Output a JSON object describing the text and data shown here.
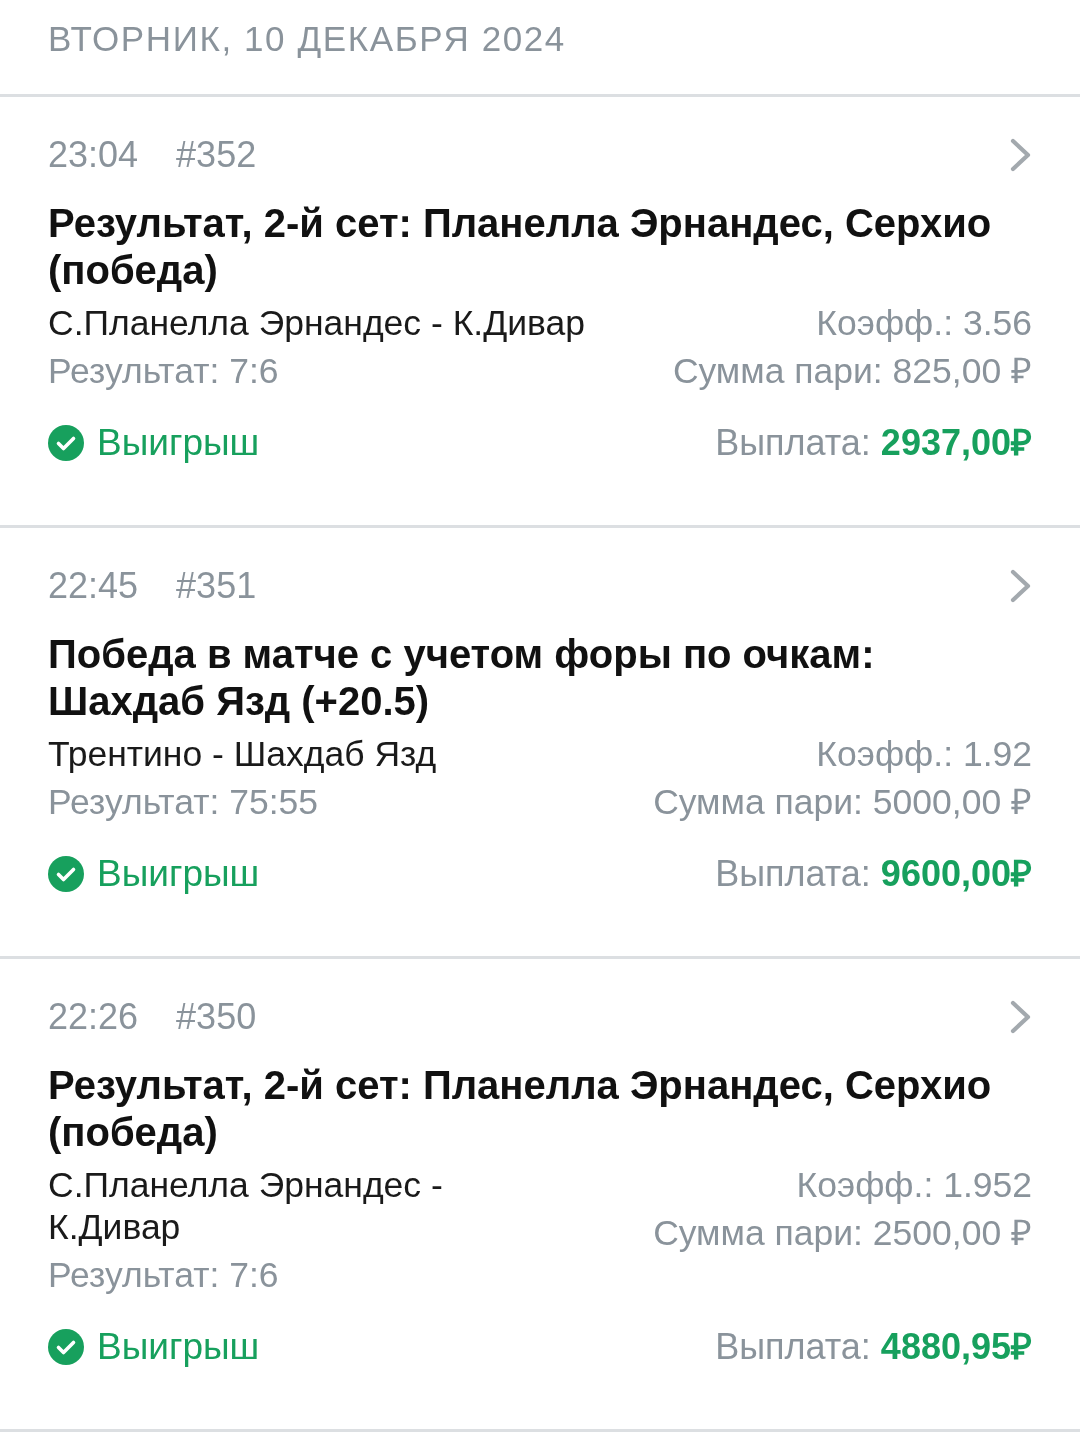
{
  "date_header": "ВТОРНИК, 10 ДЕКАБРЯ 2024",
  "bets": [
    {
      "time": "23:04",
      "number": "#352",
      "title": "Результат, 2-й сет: Планелла Эрнандес, Серхио (победа)",
      "match": "С.Планелла Эрнандес - К.Дивар",
      "result": "Результат: 7:6",
      "coefficient": "Коэфф.: 3.56",
      "stake": "Сумма пари: 825,00 ₽",
      "status": {
        "kind": "won",
        "label": "Выигрыш"
      },
      "payout_label": "Выплата:",
      "payout_amount": "2937,00₽"
    },
    {
      "time": "22:45",
      "number": "#351",
      "title": "Победа в матче с учетом форы по очкам: Шахдаб Язд (+20.5)",
      "match": "Трентино - Шахдаб Язд",
      "result": "Результат: 75:55",
      "coefficient": "Коэфф.: 1.92",
      "stake": "Сумма пари: 5000,00 ₽",
      "status": {
        "kind": "won",
        "label": "Выигрыш"
      },
      "payout_label": "Выплата:",
      "payout_amount": "9600,00₽"
    },
    {
      "time": "22:26",
      "number": "#350",
      "title": "Результат, 2-й сет: Планелла Эрнандес, Серхио (победа)",
      "match": "С.Планелла Эрнандес - К.Дивар",
      "result": "Результат: 7:6",
      "coefficient": "Коэфф.: 1.952",
      "stake": "Сумма пари: 2500,00 ₽",
      "status": {
        "kind": "won",
        "label": "Выигрыш"
      },
      "payout_label": "Выплата:",
      "payout_amount": "4880,95₽"
    }
  ]
}
